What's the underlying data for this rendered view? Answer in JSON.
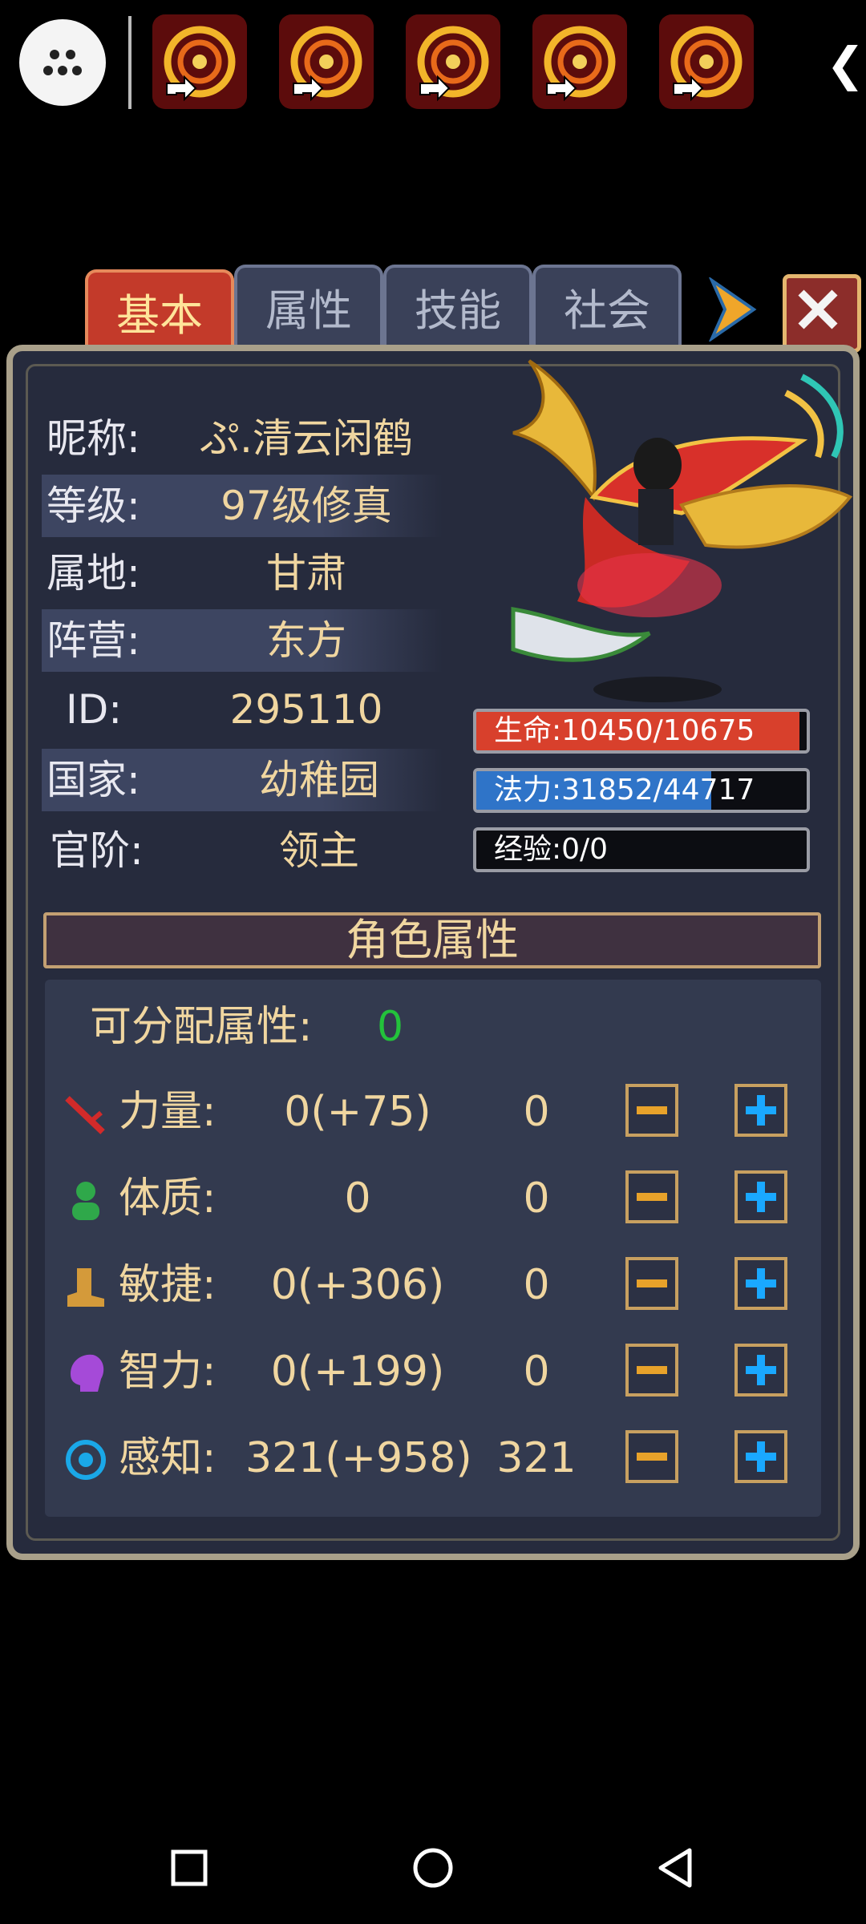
{
  "topbar": {
    "shortcuts": [
      "game-shortcut-1",
      "game-shortcut-2",
      "game-shortcut-3",
      "game-shortcut-4",
      "game-shortcut-5"
    ],
    "collapse_glyph": "❮"
  },
  "tabs": [
    {
      "label": "基本",
      "active": true
    },
    {
      "label": "属性",
      "active": false
    },
    {
      "label": "技能",
      "active": false
    },
    {
      "label": "社会",
      "active": false
    }
  ],
  "profile": {
    "nickname_label": "昵称:",
    "nickname": "ぷ.清云闲鹤",
    "level_label": "等级:",
    "level": "97级修真",
    "region_label": "属地:",
    "region": "甘肃",
    "camp_label": "阵营:",
    "camp": "东方",
    "id_label": "ID:",
    "id": "295110",
    "country_label": "国家:",
    "country": "幼稚园",
    "rank_label": "官阶:",
    "rank": "领主"
  },
  "bars": {
    "hp": {
      "text": "生命:10450/10675",
      "fraction": 0.979,
      "color": "#d8402c"
    },
    "mp": {
      "text": "法力:31852/44717",
      "fraction": 0.712,
      "color": "#2f74c8"
    },
    "exp": {
      "text": "经验:0/0",
      "fraction": 0.0,
      "color": "#999999"
    }
  },
  "attributes": {
    "title": "角色属性",
    "alloc_label": "可分配属性:",
    "alloc_value": "0",
    "stats": [
      {
        "label": "力量:",
        "value": "0(+75)",
        "base": "0",
        "icon": "sword-icon"
      },
      {
        "label": "体质:",
        "value": "0",
        "base": "0",
        "icon": "person-icon"
      },
      {
        "label": "敏捷:",
        "value": "0(+306)",
        "base": "0",
        "icon": "boot-icon"
      },
      {
        "label": "智力:",
        "value": "0(+199)",
        "base": "0",
        "icon": "head-icon"
      },
      {
        "label": "感知:",
        "value": "321(+958)",
        "base": "321",
        "icon": "eye-icon"
      }
    ]
  },
  "colors": {
    "accent_gold": "#f0d6a0",
    "alloc_green": "#23c23b",
    "plus_blue": "#1aa8ff",
    "minus_orange": "#e8a22a"
  }
}
